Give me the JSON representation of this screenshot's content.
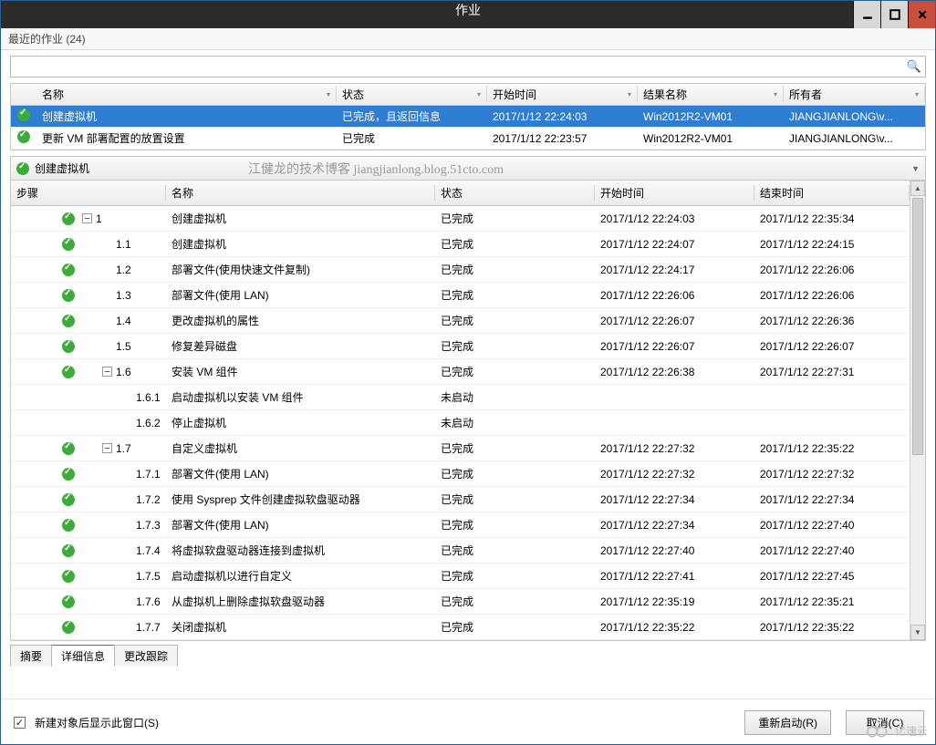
{
  "window": {
    "title": "作业"
  },
  "subheader": {
    "label": "最近的作业 (24)"
  },
  "search": {
    "placeholder": ""
  },
  "grid1": {
    "headers": {
      "name": "名称",
      "status": "状态",
      "start": "开始时间",
      "result": "结果名称",
      "owner": "所有者"
    },
    "rows": [
      {
        "name": "创建虚拟机",
        "status": "已完成，且返回信息",
        "start": "2017/1/12 22:24:03",
        "result": "Win2012R2-VM01",
        "owner": "JIANGJIANLONG\\v...",
        "selected": true
      },
      {
        "name": "更新 VM 部署配置的放置设置",
        "status": "已完成",
        "start": "2017/1/12 22:23:57",
        "result": "Win2012R2-VM01",
        "owner": "JIANGJIANLONG\\v...",
        "selected": false
      }
    ]
  },
  "detail": {
    "title": "创建虚拟机"
  },
  "watermark": "江健龙的技术博客 jiangjianlong.blog.51cto.com",
  "grid2": {
    "headers": {
      "step": "步骤",
      "name": "名称",
      "status": "状态",
      "start": "开始时间",
      "end": "结束时间"
    },
    "rows": [
      {
        "indent": 0,
        "icon": true,
        "expand": "-",
        "num": "1",
        "name": "创建虚拟机",
        "status": "已完成",
        "start": "2017/1/12 22:24:03",
        "end": "2017/1/12 22:35:34"
      },
      {
        "indent": 1,
        "icon": true,
        "expand": "",
        "num": "1.1",
        "name": "创建虚拟机",
        "status": "已完成",
        "start": "2017/1/12 22:24:07",
        "end": "2017/1/12 22:24:15"
      },
      {
        "indent": 1,
        "icon": true,
        "expand": "",
        "num": "1.2",
        "name": "部署文件(使用快速文件复制)",
        "status": "已完成",
        "start": "2017/1/12 22:24:17",
        "end": "2017/1/12 22:26:06"
      },
      {
        "indent": 1,
        "icon": true,
        "expand": "",
        "num": "1.3",
        "name": "部署文件(使用 LAN)",
        "status": "已完成",
        "start": "2017/1/12 22:26:06",
        "end": "2017/1/12 22:26:06"
      },
      {
        "indent": 1,
        "icon": true,
        "expand": "",
        "num": "1.4",
        "name": "更改虚拟机的属性",
        "status": "已完成",
        "start": "2017/1/12 22:26:07",
        "end": "2017/1/12 22:26:36"
      },
      {
        "indent": 1,
        "icon": true,
        "expand": "",
        "num": "1.5",
        "name": "修复差异磁盘",
        "status": "已完成",
        "start": "2017/1/12 22:26:07",
        "end": "2017/1/12 22:26:07"
      },
      {
        "indent": 1,
        "icon": true,
        "expand": "-",
        "num": "1.6",
        "name": "安装 VM 组件",
        "status": "已完成",
        "start": "2017/1/12 22:26:38",
        "end": "2017/1/12 22:27:31"
      },
      {
        "indent": 2,
        "icon": false,
        "expand": "",
        "num": "1.6.1",
        "name": "启动虚拟机以安装 VM 组件",
        "status": "未启动",
        "start": "",
        "end": ""
      },
      {
        "indent": 2,
        "icon": false,
        "expand": "",
        "num": "1.6.2",
        "name": "停止虚拟机",
        "status": "未启动",
        "start": "",
        "end": ""
      },
      {
        "indent": 1,
        "icon": true,
        "expand": "-",
        "num": "1.7",
        "name": "自定义虚拟机",
        "status": "已完成",
        "start": "2017/1/12 22:27:32",
        "end": "2017/1/12 22:35:22"
      },
      {
        "indent": 2,
        "icon": true,
        "expand": "",
        "num": "1.7.1",
        "name": "部署文件(使用 LAN)",
        "status": "已完成",
        "start": "2017/1/12 22:27:32",
        "end": "2017/1/12 22:27:32"
      },
      {
        "indent": 2,
        "icon": true,
        "expand": "",
        "num": "1.7.2",
        "name": "使用 Sysprep 文件创建虚拟软盘驱动器",
        "status": "已完成",
        "start": "2017/1/12 22:27:34",
        "end": "2017/1/12 22:27:34"
      },
      {
        "indent": 2,
        "icon": true,
        "expand": "",
        "num": "1.7.3",
        "name": "部署文件(使用 LAN)",
        "status": "已完成",
        "start": "2017/1/12 22:27:34",
        "end": "2017/1/12 22:27:40"
      },
      {
        "indent": 2,
        "icon": true,
        "expand": "",
        "num": "1.7.4",
        "name": "将虚拟软盘驱动器连接到虚拟机",
        "status": "已完成",
        "start": "2017/1/12 22:27:40",
        "end": "2017/1/12 22:27:40"
      },
      {
        "indent": 2,
        "icon": true,
        "expand": "",
        "num": "1.7.5",
        "name": "启动虚拟机以进行自定义",
        "status": "已完成",
        "start": "2017/1/12 22:27:41",
        "end": "2017/1/12 22:27:45"
      },
      {
        "indent": 2,
        "icon": true,
        "expand": "",
        "num": "1.7.6",
        "name": "从虚拟机上删除虚拟软盘驱动器",
        "status": "已完成",
        "start": "2017/1/12 22:35:19",
        "end": "2017/1/12 22:35:21"
      },
      {
        "indent": 2,
        "icon": true,
        "expand": "",
        "num": "1.7.7",
        "name": "关闭虚拟机",
        "status": "已完成",
        "start": "2017/1/12 22:35:22",
        "end": "2017/1/12 22:35:22"
      }
    ]
  },
  "tabs": {
    "t1": "摘要",
    "t2": "详细信息",
    "t3": "更改跟踪"
  },
  "footer": {
    "checkbox_label": "新建对象后显示此窗口(S)",
    "restart": "重新启动(R)",
    "cancel": "取消(C)"
  },
  "brand": "亿速云"
}
